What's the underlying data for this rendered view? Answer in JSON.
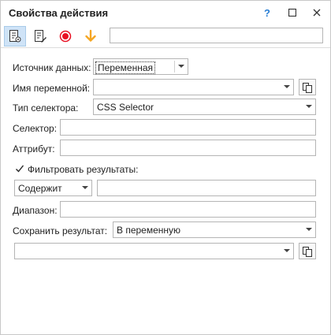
{
  "window": {
    "title": "Свойства действия"
  },
  "titlebar": {
    "help": "?"
  },
  "colors": {
    "record": "#e81123",
    "arrow": "#f5a623",
    "active_tool": "#cfe3f7"
  },
  "toolbar": {
    "icons": [
      "document-settings-icon",
      "document-edit-icon",
      "record-icon",
      "arrow-down-icon"
    ],
    "input_value": ""
  },
  "form": {
    "data_source": {
      "label": "Источник данных:",
      "value": "Переменная"
    },
    "var_name": {
      "label": "Имя переменной:",
      "value": ""
    },
    "selector_type": {
      "label": "Тип селектора:",
      "value": "CSS Selector"
    },
    "selector": {
      "label": "Селектор:",
      "value": ""
    },
    "attribute": {
      "label": "Аттрибут:",
      "value": ""
    },
    "filter": {
      "label": "Фильтровать результаты:",
      "checked": true,
      "mode": "Содержит",
      "value": ""
    },
    "range": {
      "label": "Диапазон:",
      "value": ""
    },
    "save_result": {
      "label": "Сохранить результат:",
      "value": "В переменную"
    },
    "save_var": {
      "value": ""
    }
  }
}
